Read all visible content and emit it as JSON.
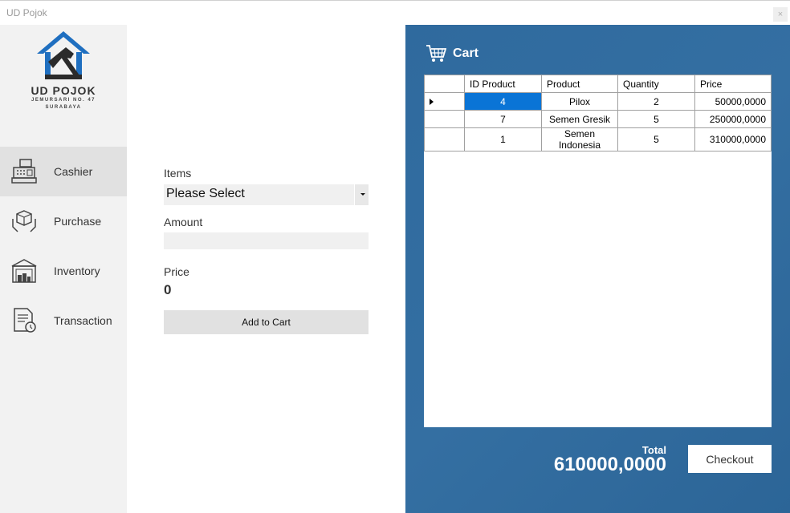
{
  "window": {
    "title": "UD Pojok",
    "close_glyph": "×"
  },
  "brand": {
    "name": "UD POJOK",
    "address_line1": "JEMURSARI NO. 47",
    "address_line2": "SURABAYA",
    "color": "#1f6fc0"
  },
  "sidebar": {
    "items": [
      {
        "label": "Cashier",
        "icon": "cash-register-icon",
        "active": true
      },
      {
        "label": "Purchase",
        "icon": "hands-box-icon",
        "active": false
      },
      {
        "label": "Inventory",
        "icon": "warehouse-icon",
        "active": false
      },
      {
        "label": "Transaction",
        "icon": "document-clock-icon",
        "active": false
      }
    ]
  },
  "form": {
    "items_label": "Items",
    "items_selected": "Please Select",
    "amount_label": "Amount",
    "amount_value": "",
    "price_label": "Price",
    "price_value": "0",
    "add_button": "Add to Cart"
  },
  "cart": {
    "title": "Cart",
    "icon": "shopping-cart-icon",
    "columns": [
      "ID Product",
      "Product",
      "Quantity",
      "Price"
    ],
    "rows": [
      [
        "4",
        "Pilox",
        "2",
        "50000,0000"
      ],
      [
        "7",
        "Semen Gresik",
        "5",
        "250000,0000"
      ],
      [
        "1",
        "Semen Indonesia",
        "5",
        "310000,0000"
      ]
    ],
    "total_label": "Total",
    "total_value": "610000,0000",
    "checkout_button": "Checkout",
    "panel_color": "#2f6a9e",
    "selection_color": "#0a74d6"
  }
}
